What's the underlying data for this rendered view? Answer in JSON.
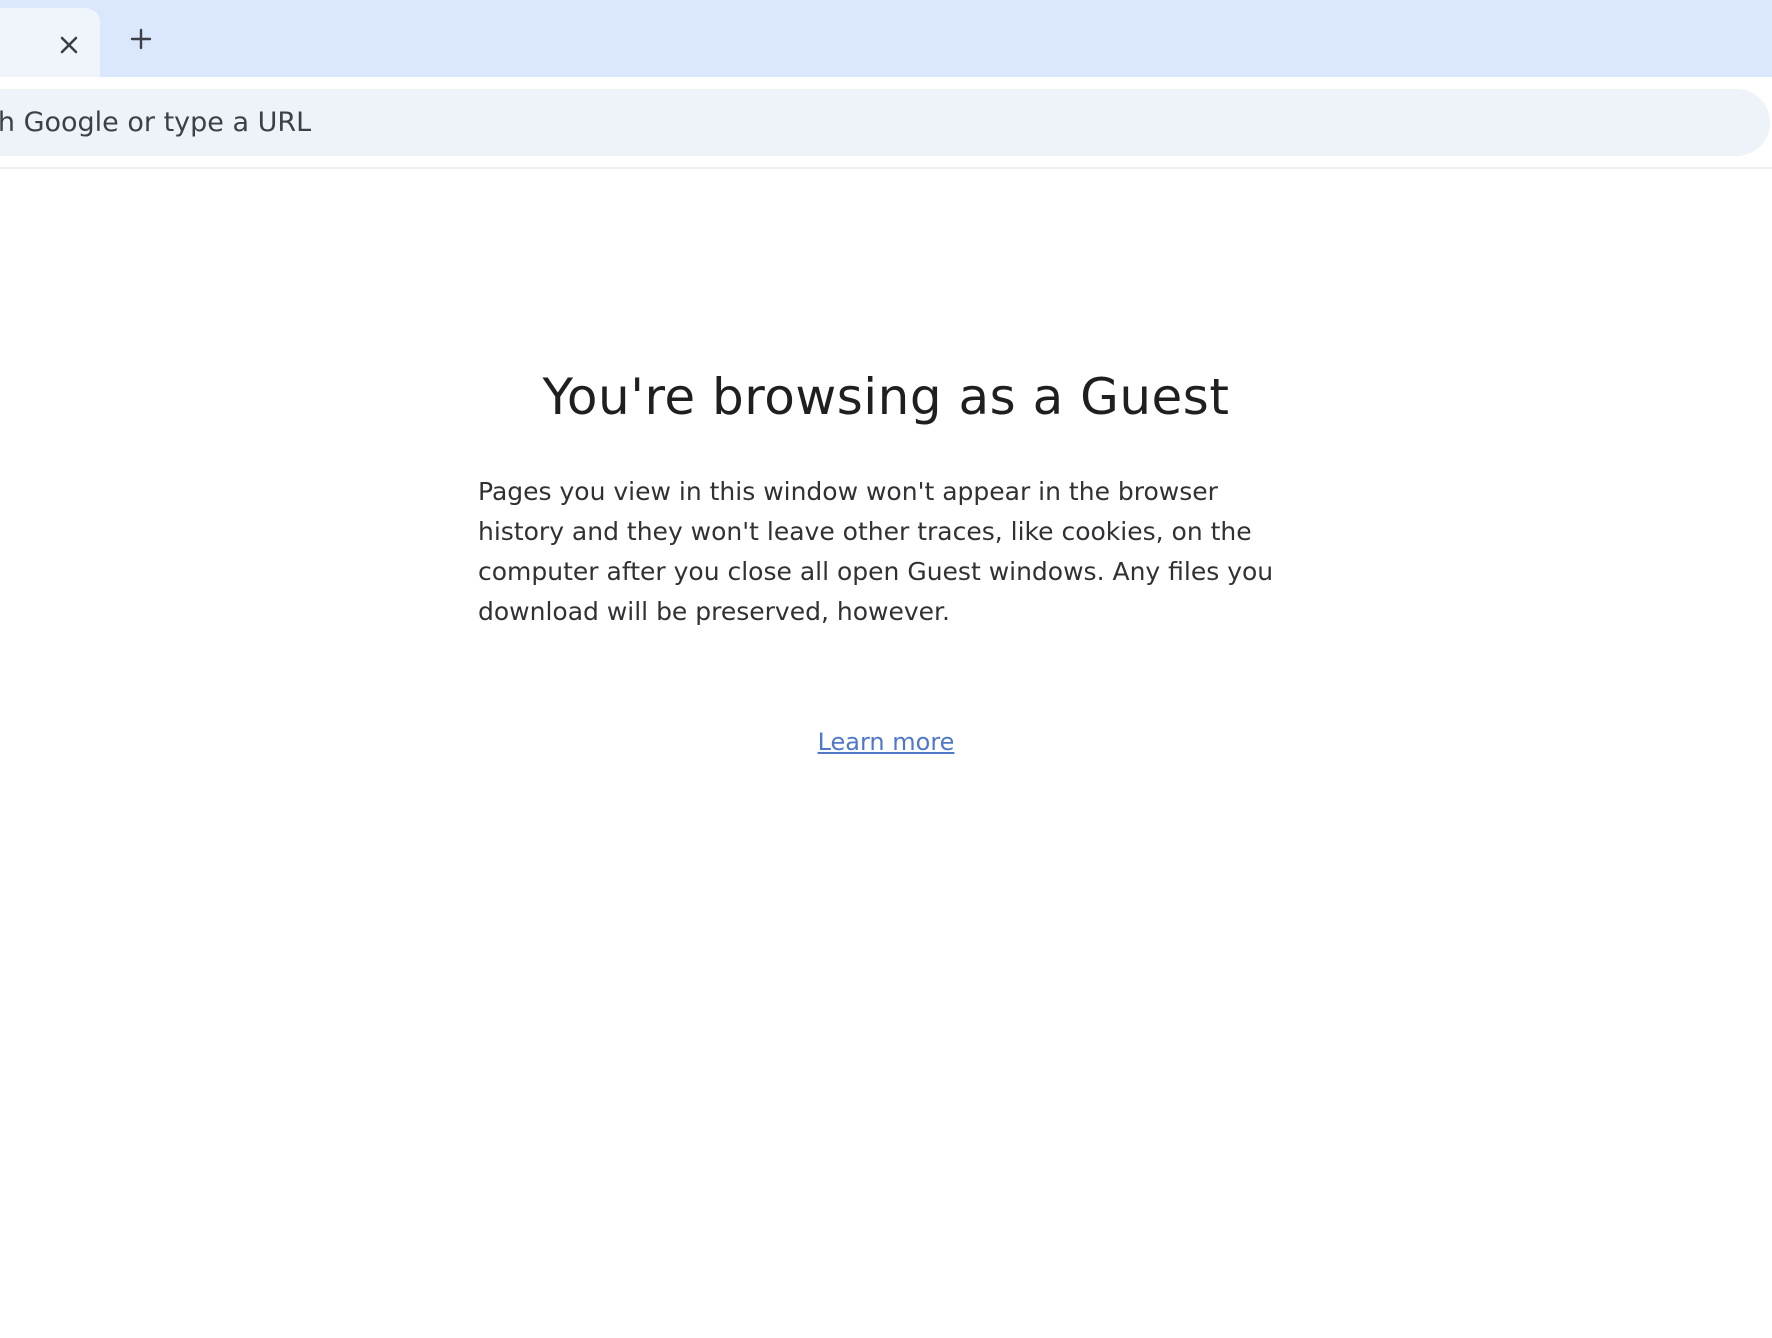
{
  "tabstrip": {
    "close_icon": "close-icon",
    "new_tab_icon": "plus-icon"
  },
  "omnibox": {
    "placeholder": "Search Google or type a URL",
    "placeholder_cut": "Search",
    "placeholder_visible": " Google or type a URL"
  },
  "content": {
    "headline": "You're browsing as a Guest",
    "description": "Pages you view in this window won't appear in the browser history and they won't leave other traces, like cookies, on the computer after you close all open Guest windows. Any files you download will be preserved, however.",
    "learn_more": "Learn more"
  },
  "colors": {
    "tabstrip_bg": "#dbe7fd",
    "omnibox_bg": "#eef2f9",
    "link": "#5078c9"
  }
}
